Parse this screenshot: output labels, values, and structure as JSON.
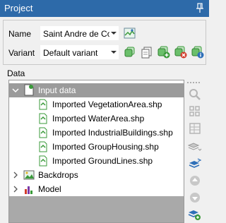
{
  "titlebar": {
    "title": "Project",
    "pin_icon": "pin-icon"
  },
  "project": {
    "name_label": "Name",
    "name_value": "Saint Andre de Cor",
    "variant_label": "Variant",
    "variant_value": "Default variant"
  },
  "data_section": {
    "label": "Data"
  },
  "tree": {
    "root": {
      "label": "Input data",
      "expanded": true
    },
    "children": [
      "Imported VegetationArea.shp",
      "Imported WaterArea.shp",
      "Imported IndustrialBuildings.shp",
      "Imported GroupHousing.shp",
      "Imported GroundLines.shp"
    ],
    "backdrops": {
      "label": "Backdrops"
    },
    "model": {
      "label": "Model"
    }
  },
  "colors": {
    "titlebar": "#2d6aa9",
    "selection": "#9b9b9b",
    "accent_green": "#3a9a3a",
    "accent_blue": "#2e6fb8",
    "accent_red": "#d23b2b"
  }
}
